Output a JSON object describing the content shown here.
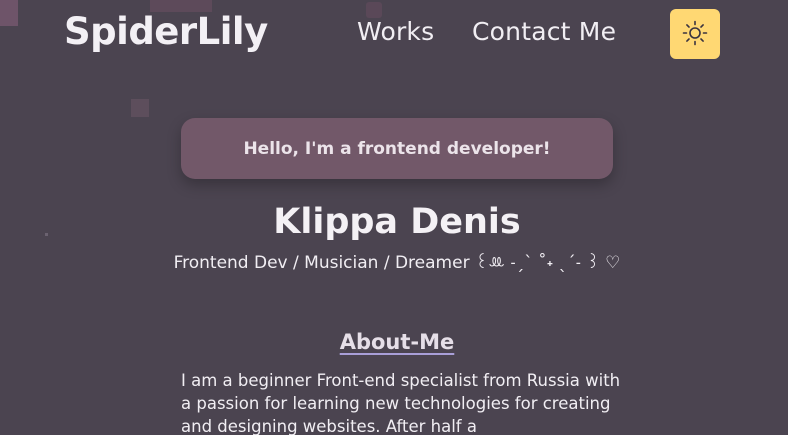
{
  "header": {
    "logo": "SpiderLily",
    "nav": {
      "works": "Works",
      "contact": "Contact Me"
    },
    "theme_toggle_icon": "sun-icon"
  },
  "hero": {
    "greeting": "Hello, I'm a frontend developer!",
    "name": "Klippa Denis",
    "tagline": "Frontend Dev / Musician / Dreamer ꒰ꔛ ˗ˏˋ ˚˖ ˎˊ˗ ꒱ ♡"
  },
  "about": {
    "title": "About-Me",
    "text": "I am a beginner Front-end specialist from Russia with a passion for learning new technologies for creating and designing websites. After half a"
  },
  "colors": {
    "background": "#4b4450",
    "greeting_card": "#725869",
    "theme_button": "#ffd873",
    "about_underline": "#a99fd8"
  }
}
